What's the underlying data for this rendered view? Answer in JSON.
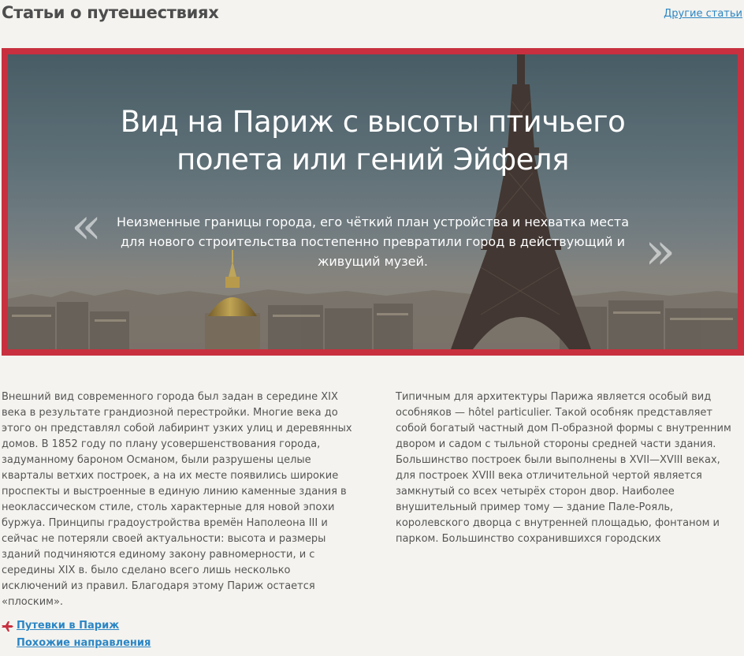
{
  "header": {
    "title": "Статьи о путешествиях",
    "other_articles": "Другие статьи"
  },
  "hero": {
    "title": "Вид на Париж с высоты птичьего полета или гений Эйфеля",
    "description": "Неизменные границы города, его чёткий план устройства и нехватка места для нового строительства постепенно превратили город в действующий и живущий музей.",
    "prev_glyph": "«",
    "next_glyph": "»",
    "frame_color": "#c8303f",
    "image_semantic": "eiffel-tower-paris-panorama"
  },
  "article": {
    "left_text": "Внешний вид современного города был задан в середине XIX века в результате грандиозной перестройки. Многие века до этого он представлял собой лабиринт узких улиц и деревянных домов. В 1852 году по плану усовершенствования города, задуманному бароном Османом, были разрушены целые кварталы ветхих построек, а на их месте появились широкие проспекты и выстроенные в единую линию каменные здания в неоклассическом стиле, столь характерные для новой эпохи буржуа. Принципы градоустройства времён Наполеона III и сейчас не потеряли своей актуальности: высота и размеры зданий подчиняются единому закону равномерности, и с середины XIX в. было сделано всего лишь несколько исключений из правил. Благодаря этому Париж остается «плоским».",
    "right_text": "Типичным для архитектуры Парижа является особый вид особняков — hôtel particulier. Такой особняк представляет собой богатый частный дом П-образной формы с внутренним двором и садом с тыльной стороны средней части здания. Большинство построек были выполнены в XVII—XVIII веках, для построек XVIII века отличительной чертой является замкнутый со всех четырёх сторон двор. Наиболее внушительный пример тому — здание Пале-Рояль, королевского дворца с внутренней площадью, фонтаном и парком. Большинство сохранившихся городских"
  },
  "links": {
    "tours": "Путевки в Париж",
    "similar": "Похожие направления",
    "icon": "plane-icon",
    "link_color": "#2b86c5",
    "icon_color": "#c8303f"
  }
}
